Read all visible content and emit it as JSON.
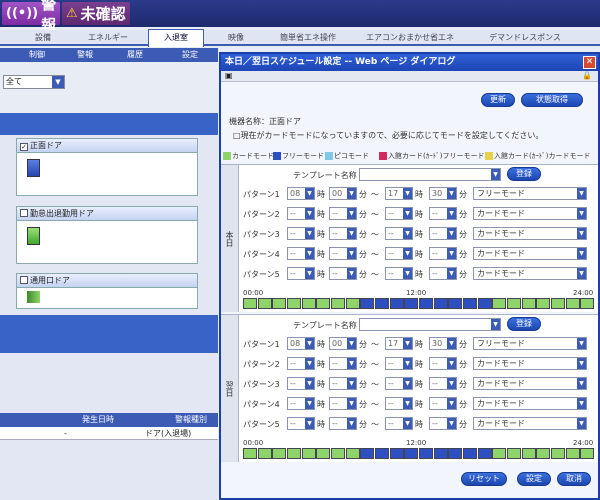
{
  "status": {
    "alarm_label": "警報",
    "unconfirmed_label": "未確認"
  },
  "main_tabs": [
    "設備",
    "エネルギー",
    "入退室",
    "映像",
    "簡単省エネ操作",
    "エアコンおまかせ省エネ",
    "デマンドレスポンス"
  ],
  "sub_tabs": [
    "制御",
    "警報",
    "履歴",
    "設定"
  ],
  "left_panel": {
    "filter_value": "全て",
    "groups": [
      {
        "label": "正面ドア",
        "checked": true
      },
      {
        "label": "勤怠出退勤用ドア",
        "checked": false
      },
      {
        "label": "通用口ドア",
        "checked": false
      }
    ],
    "events_table": {
      "headers": [
        "発生日時",
        "警報種別"
      ],
      "row": [
        "-",
        "ドア(入退場)"
      ]
    }
  },
  "dialog": {
    "title": "本日／翌日スケジュール設定 -- Web ページ ダイアログ",
    "update_button": "更新",
    "status_button": "状態取得",
    "device_name": "機器名称：正面ドア",
    "notice": "□現在がカードモードになっていますので、必要に応じてモードを設定してください。",
    "legend": [
      {
        "label": "カードモード",
        "color": "#8fd46a"
      },
      {
        "label": "フリーモード",
        "color": "#2e4fc0"
      },
      {
        "label": "ピコモード",
        "color": "#7fc8e8"
      },
      {
        "label": "入館カード(ｶｰﾄﾞ)フリーモード",
        "color": "#d02a5e"
      },
      {
        "label": "入館カード(ｶｰﾄﾞ)カードモード",
        "color": "#e6d34a"
      }
    ],
    "template_label": "テンプレート名称",
    "register_button": "登録",
    "hour_label": "時",
    "minute_label": "分",
    "tilde": "～",
    "timeline_ticks": [
      "00:00",
      "12:00",
      "24:00"
    ],
    "today": {
      "side_label": "本日",
      "patterns": [
        {
          "label": "パターン1",
          "h1": "08",
          "m1": "00",
          "h2": "17",
          "m2": "30",
          "mode": "フリーモード"
        },
        {
          "label": "パターン2",
          "h1": "--",
          "m1": "--",
          "h2": "--",
          "m2": "--",
          "mode": "カードモード"
        },
        {
          "label": "パターン3",
          "h1": "--",
          "m1": "--",
          "h2": "--",
          "m2": "--",
          "mode": "カードモード"
        },
        {
          "label": "パターン4",
          "h1": "--",
          "m1": "--",
          "h2": "--",
          "m2": "--",
          "mode": "カードモード"
        },
        {
          "label": "パターン5",
          "h1": "--",
          "m1": "--",
          "h2": "--",
          "m2": "--",
          "mode": "カードモード"
        }
      ],
      "timeline": [
        "card",
        "card",
        "card",
        "card",
        "card",
        "card",
        "card",
        "card",
        "free",
        "free",
        "free",
        "free",
        "free",
        "free",
        "free",
        "free",
        "free",
        "card",
        "card",
        "card",
        "card",
        "card",
        "card",
        "card"
      ]
    },
    "tomorrow": {
      "side_label": "翌日",
      "patterns": [
        {
          "label": "パターン1",
          "h1": "08",
          "m1": "00",
          "h2": "17",
          "m2": "30",
          "mode": "フリーモード"
        },
        {
          "label": "パターン2",
          "h1": "--",
          "m1": "--",
          "h2": "--",
          "m2": "--",
          "mode": "カードモード"
        },
        {
          "label": "パターン3",
          "h1": "--",
          "m1": "--",
          "h2": "--",
          "m2": "--",
          "mode": "カードモード"
        },
        {
          "label": "パターン4",
          "h1": "--",
          "m1": "--",
          "h2": "--",
          "m2": "--",
          "mode": "カードモード"
        },
        {
          "label": "パターン5",
          "h1": "--",
          "m1": "--",
          "h2": "--",
          "m2": "--",
          "mode": "カードモード"
        }
      ],
      "timeline": [
        "card",
        "card",
        "card",
        "card",
        "card",
        "card",
        "card",
        "card",
        "free",
        "free",
        "free",
        "free",
        "free",
        "free",
        "free",
        "free",
        "free",
        "card",
        "card",
        "card",
        "card",
        "card",
        "card",
        "card"
      ]
    },
    "reset_button": "リセット",
    "set_button": "設定",
    "cancel_button": "取消"
  },
  "colors": {
    "card": "#8fd46a",
    "free": "#2e4fc0"
  }
}
